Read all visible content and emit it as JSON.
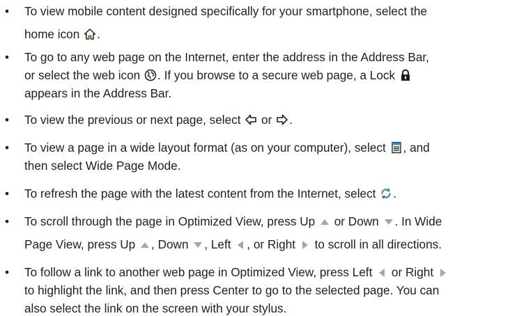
{
  "bullet_char": "•",
  "items": [
    {
      "l1a": "To view mobile content designed specifically for your smartphone, select the",
      "l2a": "home icon ",
      "l2b": "."
    },
    {
      "l1a": "To go to any web page on the Internet, enter the address in the Address Bar,",
      "l2a": "or select the web icon ",
      "l2b": ". If you browse to a secure web page, a Lock ",
      "l3a": "appears in the Address Bar."
    },
    {
      "l1a": "To view the previous or next page, select ",
      "l1b": " or ",
      "l1c": "."
    },
    {
      "l1a": "To view a page in a wide layout format (as on your computer), select ",
      "l1b": ", and",
      "l2a": "then select Wide Page Mode."
    },
    {
      "l1a": "To refresh the page with the latest content from the Internet, select ",
      "l1b": "."
    },
    {
      "l1a": "To scroll through the page in Optimized View, press Up ",
      "l1b": " or Down ",
      "l1c": ". In Wide",
      "l2a": "Page View, press Up ",
      "l2b": ", Down ",
      "l2c": ", Left ",
      "l2d": ", or Right ",
      "l2e": " to scroll in all directions."
    },
    {
      "l1a": "To follow a link to another web page in Optimized View, press Left ",
      "l1b": " or Right ",
      "l2a": "to highlight the link, and then press Center to go to the selected page. You can",
      "l3a": "also select the link on the screen with your stylus."
    }
  ],
  "icons": {
    "home": "home-icon",
    "web": "web-globe-icon",
    "lock": "lock-icon",
    "back": "back-arrow-icon",
    "forward": "forward-arrow-icon",
    "menu": "menu-icon",
    "refresh": "refresh-icon",
    "up": "up-triangle-icon",
    "down": "down-triangle-icon",
    "left": "left-triangle-icon",
    "right": "right-triangle-icon"
  },
  "colors": {
    "text": "#1f1f1f",
    "nav_triangle": "#a6a6a6",
    "icon_dark": "#1f1f1f"
  }
}
